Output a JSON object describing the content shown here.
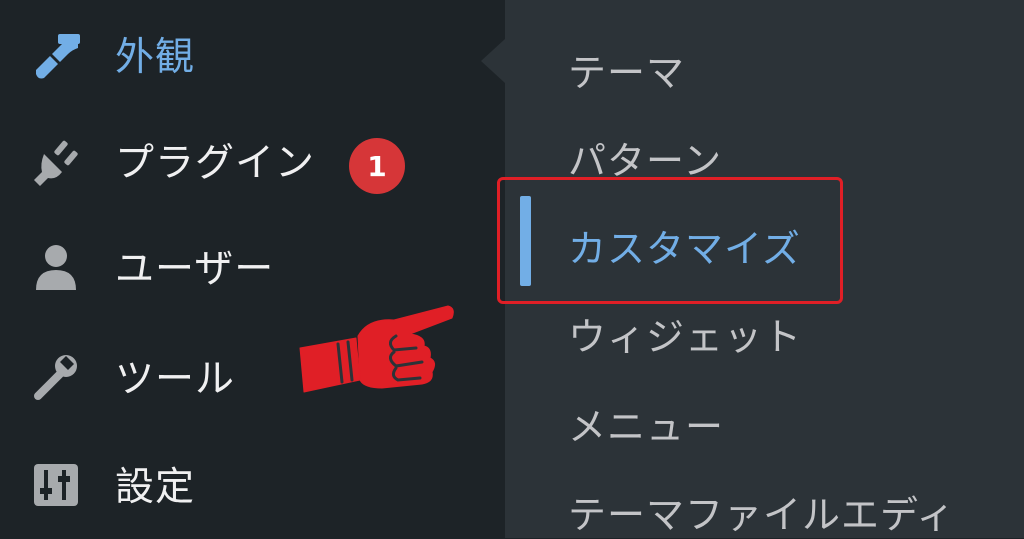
{
  "sidebar": {
    "items": [
      {
        "label": "外観",
        "icon": "paintbrush-icon",
        "current": true
      },
      {
        "label": "プラグイン",
        "icon": "plugin-icon",
        "badge": "1"
      },
      {
        "label": "ユーザー",
        "icon": "user-icon"
      },
      {
        "label": "ツール",
        "icon": "wrench-icon"
      },
      {
        "label": "設定",
        "icon": "settings-sliders-icon"
      }
    ]
  },
  "submenu": {
    "items": [
      {
        "label": "テーマ"
      },
      {
        "label": "パターン"
      },
      {
        "label": "カスタマイズ",
        "current": true
      },
      {
        "label": "ウィジェット"
      },
      {
        "label": "メニュー"
      },
      {
        "label": "テーマファイルエディ"
      }
    ]
  },
  "annotation": {
    "icon": "pointing-hand-icon",
    "highlight_color": "#e01f26"
  },
  "colors": {
    "sidebar_bg": "#1d2327",
    "submenu_bg": "#2c3338",
    "accent": "#72aee6",
    "badge": "#d63638"
  }
}
